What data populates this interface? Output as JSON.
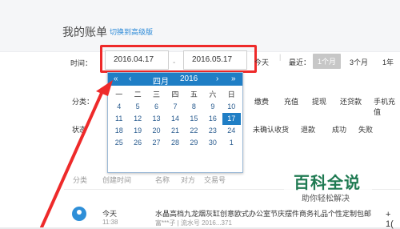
{
  "header": {
    "title": "我的账单",
    "link": "切换到高级版"
  },
  "filter": {
    "time_label": "时间：",
    "start_date": "2016.04.17",
    "end_date": "2016.05.17",
    "dash": "-",
    "today": "今天",
    "recent_label": "最近：",
    "quick": [
      "1个月",
      "3个月",
      "1年"
    ],
    "type_label": "分类：",
    "types": [
      "缴费",
      "充值",
      "提现",
      "还贷款",
      "手机充值"
    ],
    "status_label": "状态",
    "statuses": [
      "未确认收货",
      "退款",
      "成功",
      "失败"
    ]
  },
  "calendar": {
    "prev_year": "«",
    "prev_month": "‹",
    "month": "四月",
    "year": "2016",
    "next_month": "›",
    "next_year": "»",
    "weekdays": [
      "一",
      "二",
      "三",
      "四",
      "五",
      "六",
      "日"
    ],
    "days": [
      "4",
      "5",
      "6",
      "7",
      "8",
      "9",
      "10",
      "11",
      "12",
      "13",
      "14",
      "15",
      "16",
      "17",
      "18",
      "19",
      "20",
      "21",
      "22",
      "23",
      "24",
      "25",
      "26",
      "27",
      "28",
      "29",
      "30",
      "1"
    ],
    "selected": "17"
  },
  "list": {
    "headers": [
      "分类",
      "创建时间",
      "名称",
      "对方",
      "交易号"
    ],
    "row": {
      "date": "今天",
      "time": "11:38",
      "title": "水晶高档九龙烟灰缸创意欧式办公室节庆摆件商务礼品个性定制包邮",
      "sub": "富***子 | 流水号 2016...371",
      "amount": "+ 1("
    }
  },
  "watermark": {
    "main": "百科全说",
    "sub": "助你轻松解决"
  },
  "colors": {
    "accent": "#1f7ec5",
    "highlight": "#ee2a2a"
  }
}
